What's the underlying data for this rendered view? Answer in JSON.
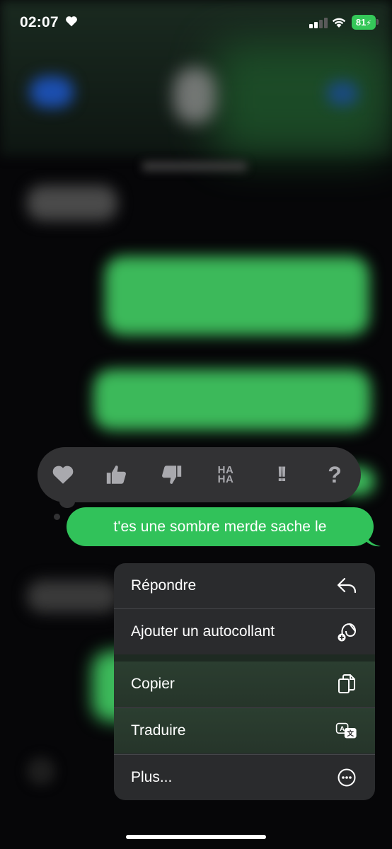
{
  "status_bar": {
    "time": "02:07",
    "heart_icon": "heart-icon",
    "battery_level": "81",
    "battery_charging": true
  },
  "tapback": {
    "reactions": [
      {
        "name": "heart",
        "icon": "heart-icon"
      },
      {
        "name": "thumbs-up",
        "icon": "thumbs-up-icon"
      },
      {
        "name": "thumbs-down",
        "icon": "thumbs-down-icon"
      },
      {
        "name": "haha",
        "label_top": "HA",
        "label_bottom": "HA"
      },
      {
        "name": "emphasize",
        "label": "!!"
      },
      {
        "name": "question",
        "label": "?"
      }
    ]
  },
  "message": {
    "text": "t'es une sombre merde sache le",
    "color": "#31c25a"
  },
  "context_menu": {
    "items": [
      {
        "label": "Répondre",
        "icon": "reply-icon"
      },
      {
        "label": "Ajouter un autocollant",
        "icon": "add-sticker-icon"
      },
      {
        "label": "Copier",
        "icon": "copy-icon"
      },
      {
        "label": "Traduire",
        "icon": "translate-icon"
      },
      {
        "label": "Plus...",
        "icon": "more-icon"
      }
    ]
  },
  "colors": {
    "accent_green": "#31c25a",
    "menu_background": "#2a2b2d",
    "tapback_background": "#323234"
  }
}
